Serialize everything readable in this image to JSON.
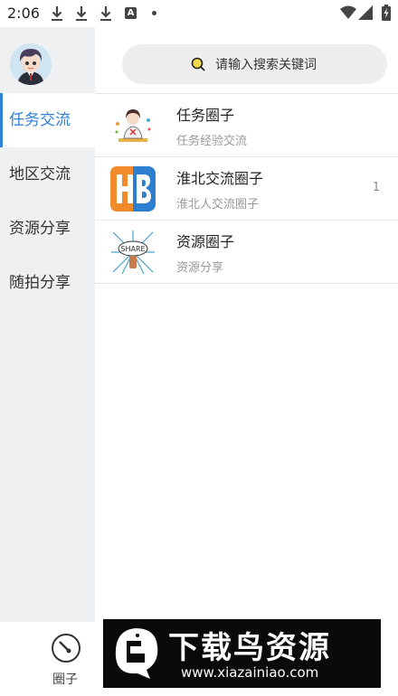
{
  "status_bar": {
    "time": "2:06",
    "icons": [
      "download-icon",
      "download-icon",
      "download-icon",
      "a-icon",
      "dot-icon",
      "wifi-icon",
      "signal-icon",
      "battery-icon"
    ],
    "a_glyph": "A"
  },
  "sidebar": {
    "items": [
      {
        "label": "任务交流",
        "active": true
      },
      {
        "label": "地区交流",
        "active": false
      },
      {
        "label": "资源分享",
        "active": false
      },
      {
        "label": "随拍分享",
        "active": false
      }
    ]
  },
  "search": {
    "placeholder": "请输入搜索关键词"
  },
  "list": [
    {
      "title": "任务圈子",
      "subtitle": "任务经验交流",
      "count": ""
    },
    {
      "title": "淮北交流圈子",
      "subtitle": "淮北人交流圈子",
      "count": "1"
    },
    {
      "title": "资源圈子",
      "subtitle": "资源分享",
      "count": ""
    }
  ],
  "list_icons": {
    "hb_text": "HB",
    "share_text": "SHARE"
  },
  "bottom_tab": {
    "label": "圈子"
  },
  "watermark": {
    "title": "下载鸟资源",
    "url": "www.xiazainiao.com"
  },
  "colors": {
    "accent": "#2f80d8",
    "sidebar_bg": "#eff0f2",
    "search_bg": "#eeeeee"
  }
}
